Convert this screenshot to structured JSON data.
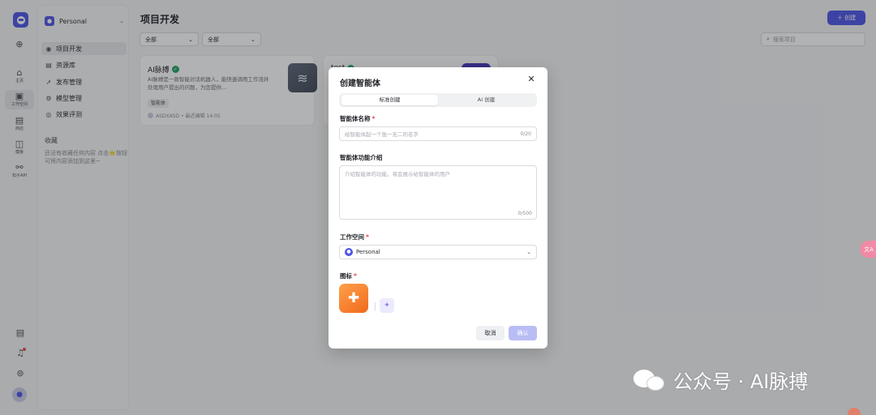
{
  "rail": {
    "items": [
      {
        "label": "",
        "icon": "plus-circle-icon"
      },
      {
        "label": "主页",
        "icon": "home-icon"
      },
      {
        "label": "工作空间",
        "icon": "terminal-icon"
      },
      {
        "label": "商店",
        "icon": "store-icon"
      },
      {
        "label": "模板",
        "icon": "template-icon"
      },
      {
        "label": "扣子API",
        "icon": "api-icon"
      }
    ]
  },
  "sidebar": {
    "workspace": "Personal",
    "nav": [
      {
        "label": "项目开发",
        "icon": "project-icon"
      },
      {
        "label": "资源库",
        "icon": "library-icon"
      },
      {
        "label": "发布管理",
        "icon": "publish-icon"
      },
      {
        "label": "模型管理",
        "icon": "model-icon"
      },
      {
        "label": "效果评测",
        "icon": "evaluation-icon"
      }
    ],
    "favorites_title": "收藏",
    "favorites_empty": "还没有收藏任何内容 点击⭐按钮可将内容添加到这里~"
  },
  "main": {
    "title": "项目开发",
    "create_label": "＋ 创建",
    "filter1": "全部",
    "filter2": "全部",
    "search_placeholder": "搜索项目",
    "card": {
      "title": "AI脉搏",
      "desc": "AI脉搏是一款智能对话机器人，能快速调用工作流并处理用户提出的问题，为您提供…",
      "tag": "智能体",
      "meta": "ASDXASD • 最近编辑 14:05"
    },
    "card2": {
      "title": "test"
    }
  },
  "modal": {
    "title": "创建智能体",
    "close": "✕",
    "tabs": [
      "标准创建",
      "AI 创建"
    ],
    "name_label": "智能体名称",
    "name_placeholder": "给智能体起一个独一无二的名字",
    "name_count": "0/20",
    "desc_label": "智能体功能介绍",
    "desc_placeholder": "介绍智能体的功能，将会展示给智能体的用户",
    "desc_count": "0/500",
    "workspace_label": "工作空间",
    "workspace_value": "Personal",
    "icon_label": "图标",
    "cancel": "取消",
    "confirm": "确认"
  },
  "watermark": {
    "text": "公众号 · AI脉搏"
  },
  "colors": {
    "accent": "#4e55e6",
    "confirm_disabled": "#b9bdf5",
    "required": "#e5484d",
    "verified": "#21a366"
  }
}
